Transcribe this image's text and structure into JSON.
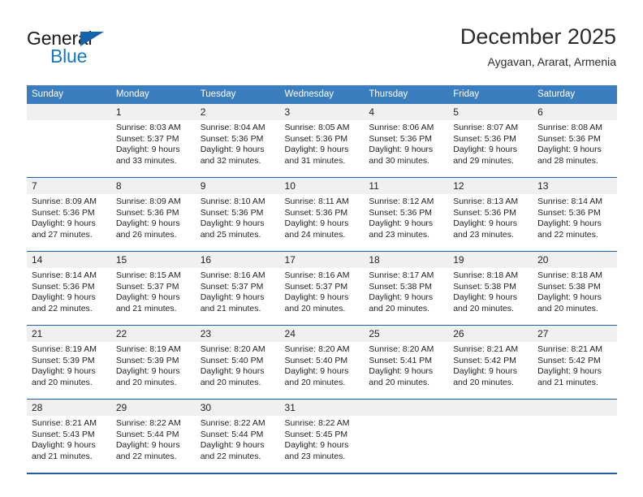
{
  "brand": {
    "name_dark": "General",
    "name_blue": "Blue",
    "logo_color": "#1664ab",
    "blue_text_color": "#1877c4"
  },
  "header": {
    "title": "December 2025",
    "subtitle": "Aygavan, Ararat, Armenia"
  },
  "theme": {
    "header_row_bg": "#3a7ebf",
    "row_rule": "#1e5fa3",
    "daynum_bg": "#f0f0f0"
  },
  "calendar": {
    "weekday_headers": [
      "Sunday",
      "Monday",
      "Tuesday",
      "Wednesday",
      "Thursday",
      "Friday",
      "Saturday"
    ],
    "weeks": [
      [
        {
          "day": "",
          "sunrise": "",
          "sunset": "",
          "daylight_line1": "",
          "daylight_line2": ""
        },
        {
          "day": "1",
          "sunrise": "Sunrise: 8:03 AM",
          "sunset": "Sunset: 5:37 PM",
          "daylight_line1": "Daylight: 9 hours",
          "daylight_line2": "and 33 minutes."
        },
        {
          "day": "2",
          "sunrise": "Sunrise: 8:04 AM",
          "sunset": "Sunset: 5:36 PM",
          "daylight_line1": "Daylight: 9 hours",
          "daylight_line2": "and 32 minutes."
        },
        {
          "day": "3",
          "sunrise": "Sunrise: 8:05 AM",
          "sunset": "Sunset: 5:36 PM",
          "daylight_line1": "Daylight: 9 hours",
          "daylight_line2": "and 31 minutes."
        },
        {
          "day": "4",
          "sunrise": "Sunrise: 8:06 AM",
          "sunset": "Sunset: 5:36 PM",
          "daylight_line1": "Daylight: 9 hours",
          "daylight_line2": "and 30 minutes."
        },
        {
          "day": "5",
          "sunrise": "Sunrise: 8:07 AM",
          "sunset": "Sunset: 5:36 PM",
          "daylight_line1": "Daylight: 9 hours",
          "daylight_line2": "and 29 minutes."
        },
        {
          "day": "6",
          "sunrise": "Sunrise: 8:08 AM",
          "sunset": "Sunset: 5:36 PM",
          "daylight_line1": "Daylight: 9 hours",
          "daylight_line2": "and 28 minutes."
        }
      ],
      [
        {
          "day": "7",
          "sunrise": "Sunrise: 8:09 AM",
          "sunset": "Sunset: 5:36 PM",
          "daylight_line1": "Daylight: 9 hours",
          "daylight_line2": "and 27 minutes."
        },
        {
          "day": "8",
          "sunrise": "Sunrise: 8:09 AM",
          "sunset": "Sunset: 5:36 PM",
          "daylight_line1": "Daylight: 9 hours",
          "daylight_line2": "and 26 minutes."
        },
        {
          "day": "9",
          "sunrise": "Sunrise: 8:10 AM",
          "sunset": "Sunset: 5:36 PM",
          "daylight_line1": "Daylight: 9 hours",
          "daylight_line2": "and 25 minutes."
        },
        {
          "day": "10",
          "sunrise": "Sunrise: 8:11 AM",
          "sunset": "Sunset: 5:36 PM",
          "daylight_line1": "Daylight: 9 hours",
          "daylight_line2": "and 24 minutes."
        },
        {
          "day": "11",
          "sunrise": "Sunrise: 8:12 AM",
          "sunset": "Sunset: 5:36 PM",
          "daylight_line1": "Daylight: 9 hours",
          "daylight_line2": "and 23 minutes."
        },
        {
          "day": "12",
          "sunrise": "Sunrise: 8:13 AM",
          "sunset": "Sunset: 5:36 PM",
          "daylight_line1": "Daylight: 9 hours",
          "daylight_line2": "and 23 minutes."
        },
        {
          "day": "13",
          "sunrise": "Sunrise: 8:14 AM",
          "sunset": "Sunset: 5:36 PM",
          "daylight_line1": "Daylight: 9 hours",
          "daylight_line2": "and 22 minutes."
        }
      ],
      [
        {
          "day": "14",
          "sunrise": "Sunrise: 8:14 AM",
          "sunset": "Sunset: 5:36 PM",
          "daylight_line1": "Daylight: 9 hours",
          "daylight_line2": "and 22 minutes."
        },
        {
          "day": "15",
          "sunrise": "Sunrise: 8:15 AM",
          "sunset": "Sunset: 5:37 PM",
          "daylight_line1": "Daylight: 9 hours",
          "daylight_line2": "and 21 minutes."
        },
        {
          "day": "16",
          "sunrise": "Sunrise: 8:16 AM",
          "sunset": "Sunset: 5:37 PM",
          "daylight_line1": "Daylight: 9 hours",
          "daylight_line2": "and 21 minutes."
        },
        {
          "day": "17",
          "sunrise": "Sunrise: 8:16 AM",
          "sunset": "Sunset: 5:37 PM",
          "daylight_line1": "Daylight: 9 hours",
          "daylight_line2": "and 20 minutes."
        },
        {
          "day": "18",
          "sunrise": "Sunrise: 8:17 AM",
          "sunset": "Sunset: 5:38 PM",
          "daylight_line1": "Daylight: 9 hours",
          "daylight_line2": "and 20 minutes."
        },
        {
          "day": "19",
          "sunrise": "Sunrise: 8:18 AM",
          "sunset": "Sunset: 5:38 PM",
          "daylight_line1": "Daylight: 9 hours",
          "daylight_line2": "and 20 minutes."
        },
        {
          "day": "20",
          "sunrise": "Sunrise: 8:18 AM",
          "sunset": "Sunset: 5:38 PM",
          "daylight_line1": "Daylight: 9 hours",
          "daylight_line2": "and 20 minutes."
        }
      ],
      [
        {
          "day": "21",
          "sunrise": "Sunrise: 8:19 AM",
          "sunset": "Sunset: 5:39 PM",
          "daylight_line1": "Daylight: 9 hours",
          "daylight_line2": "and 20 minutes."
        },
        {
          "day": "22",
          "sunrise": "Sunrise: 8:19 AM",
          "sunset": "Sunset: 5:39 PM",
          "daylight_line1": "Daylight: 9 hours",
          "daylight_line2": "and 20 minutes."
        },
        {
          "day": "23",
          "sunrise": "Sunrise: 8:20 AM",
          "sunset": "Sunset: 5:40 PM",
          "daylight_line1": "Daylight: 9 hours",
          "daylight_line2": "and 20 minutes."
        },
        {
          "day": "24",
          "sunrise": "Sunrise: 8:20 AM",
          "sunset": "Sunset: 5:40 PM",
          "daylight_line1": "Daylight: 9 hours",
          "daylight_line2": "and 20 minutes."
        },
        {
          "day": "25",
          "sunrise": "Sunrise: 8:20 AM",
          "sunset": "Sunset: 5:41 PM",
          "daylight_line1": "Daylight: 9 hours",
          "daylight_line2": "and 20 minutes."
        },
        {
          "day": "26",
          "sunrise": "Sunrise: 8:21 AM",
          "sunset": "Sunset: 5:42 PM",
          "daylight_line1": "Daylight: 9 hours",
          "daylight_line2": "and 20 minutes."
        },
        {
          "day": "27",
          "sunrise": "Sunrise: 8:21 AM",
          "sunset": "Sunset: 5:42 PM",
          "daylight_line1": "Daylight: 9 hours",
          "daylight_line2": "and 21 minutes."
        }
      ],
      [
        {
          "day": "28",
          "sunrise": "Sunrise: 8:21 AM",
          "sunset": "Sunset: 5:43 PM",
          "daylight_line1": "Daylight: 9 hours",
          "daylight_line2": "and 21 minutes."
        },
        {
          "day": "29",
          "sunrise": "Sunrise: 8:22 AM",
          "sunset": "Sunset: 5:44 PM",
          "daylight_line1": "Daylight: 9 hours",
          "daylight_line2": "and 22 minutes."
        },
        {
          "day": "30",
          "sunrise": "Sunrise: 8:22 AM",
          "sunset": "Sunset: 5:44 PM",
          "daylight_line1": "Daylight: 9 hours",
          "daylight_line2": "and 22 minutes."
        },
        {
          "day": "31",
          "sunrise": "Sunrise: 8:22 AM",
          "sunset": "Sunset: 5:45 PM",
          "daylight_line1": "Daylight: 9 hours",
          "daylight_line2": "and 23 minutes."
        },
        {
          "day": "",
          "sunrise": "",
          "sunset": "",
          "daylight_line1": "",
          "daylight_line2": ""
        },
        {
          "day": "",
          "sunrise": "",
          "sunset": "",
          "daylight_line1": "",
          "daylight_line2": ""
        },
        {
          "day": "",
          "sunrise": "",
          "sunset": "",
          "daylight_line1": "",
          "daylight_line2": ""
        }
      ]
    ]
  }
}
